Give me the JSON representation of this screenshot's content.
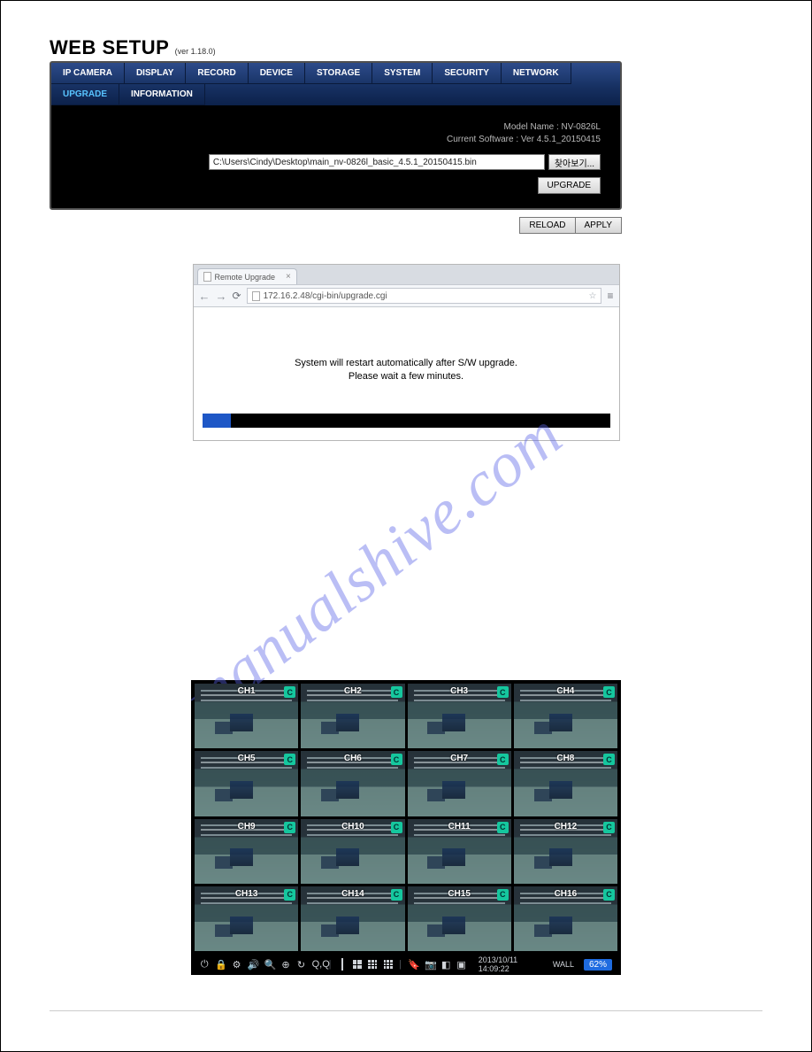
{
  "title": {
    "main": "WEB SETUP",
    "ver": "(ver 1.18.0)"
  },
  "tabs": [
    "IP CAMERA",
    "DISPLAY",
    "RECORD",
    "DEVICE",
    "STORAGE",
    "SYSTEM",
    "SECURITY",
    "NETWORK",
    "UPGRADE",
    "INFORMATION"
  ],
  "active_tab": "UPGRADE",
  "device": {
    "model_line": "Model Name : NV-0826L",
    "sw_line": "Current Software : Ver 4.5.1_20150415"
  },
  "path_value": "C:\\Users\\Cindy\\Desktop\\main_nv-0826l_basic_4.5.1_20150415.bin",
  "browse_label": "찾아보기...",
  "upgrade_btn": "UPGRADE",
  "reload_btn": "RELOAD",
  "apply_btn": "APPLY",
  "browser": {
    "tab_title": "Remote Upgrade",
    "url": "172.16.2.48/cgi-bin/upgrade.cgi",
    "msg_line1": "System will restart automatically after S/W upgrade.",
    "msg_line2": "Please wait a few minutes.",
    "progress_pct": 7
  },
  "watermark": "manualshive.com",
  "channels": [
    "CH1",
    "CH2",
    "CH3",
    "CH4",
    "CH5",
    "CH6",
    "CH7",
    "CH8",
    "CH9",
    "CH10",
    "CH11",
    "CH12",
    "CH13",
    "CH14",
    "CH15",
    "CH16"
  ],
  "ch_badge": "C",
  "ctrl": {
    "qlq": "Q,Q",
    "timestamp": "2013/10/11 14:09:22",
    "wall": "WALL",
    "percent": "62%"
  }
}
